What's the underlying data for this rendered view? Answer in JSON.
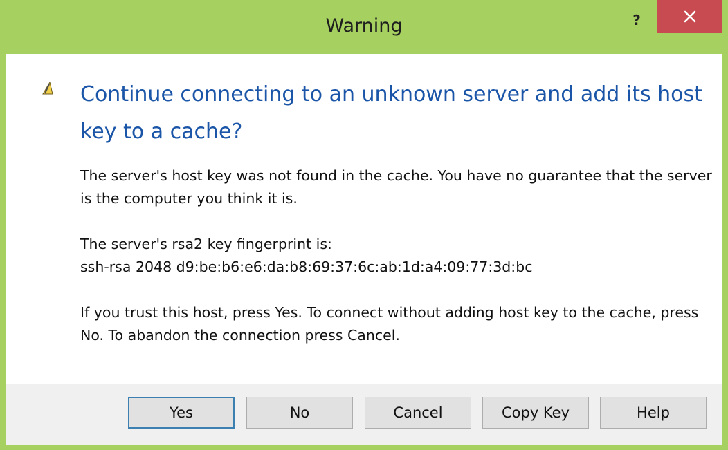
{
  "window": {
    "title": "Warning",
    "help_label": "?",
    "accent_color": "#a6d05f",
    "close_color": "#c74b50"
  },
  "dialog": {
    "icon": "warning-icon",
    "main_instruction": "Continue connecting to an unknown server and add its host key to a cache?",
    "paragraphs": [
      "The server's host key was not found in the cache. You have no guarantee that the server is the computer you think it is.",
      "The server's rsa2 key fingerprint is:",
      "ssh-rsa 2048 d9:be:b6:e6:da:b8:69:37:6c:ab:1d:a4:09:77:3d:bc",
      "If you trust this host, press Yes. To connect without adding host key to the cache, press No. To abandon the connection press Cancel."
    ]
  },
  "buttons": {
    "yes": "Yes",
    "no": "No",
    "cancel": "Cancel",
    "copy_key": "Copy Key",
    "help": "Help"
  }
}
